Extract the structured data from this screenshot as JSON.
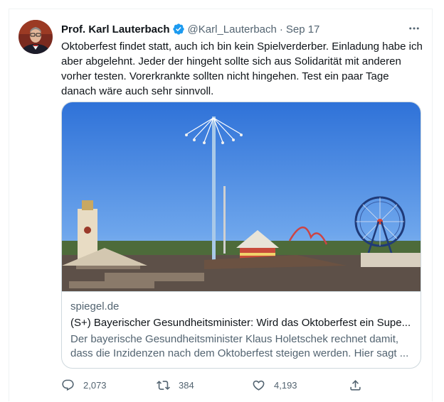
{
  "tweet": {
    "author_name": "Prof. Karl Lauterbach",
    "handle": "@Karl_Lauterbach",
    "separator": "·",
    "date": "Sep 17",
    "text": "Oktoberfest findet statt, auch ich bin kein Spielverderber. Einladung habe ich aber abgelehnt. Jeder der hingeht sollte sich aus Solidarität mit anderen vorher testen. Vorerkrankte sollten nicht hingehen. Test ein paar Tage danach wäre auch sehr sinnvoll.",
    "verified_icon": "verified-badge-icon",
    "more_icon": "more-options-icon"
  },
  "link_card": {
    "domain": "spiegel.de",
    "title": "(S+) Bayerischer Gesundheitsminister: Wird das Oktoberfest ein Supe...",
    "description": "Der bayerische Gesundheitsminister Klaus Holetschek rechnet damit, dass die Inzidenzen nach dem Oktoberfest steigen werden. Hier sagt ...",
    "image_subject": "oktoberfest-fairground-photo"
  },
  "actions": {
    "replies": "2,073",
    "retweets": "384",
    "likes": "4,193",
    "reply_icon": "reply-icon",
    "retweet_icon": "retweet-icon",
    "like_icon": "heart-icon",
    "share_icon": "share-icon"
  },
  "colors": {
    "accent": "#1d9bf0",
    "text_primary": "#0f1419",
    "text_secondary": "#536471",
    "border": "#cfd9de"
  }
}
